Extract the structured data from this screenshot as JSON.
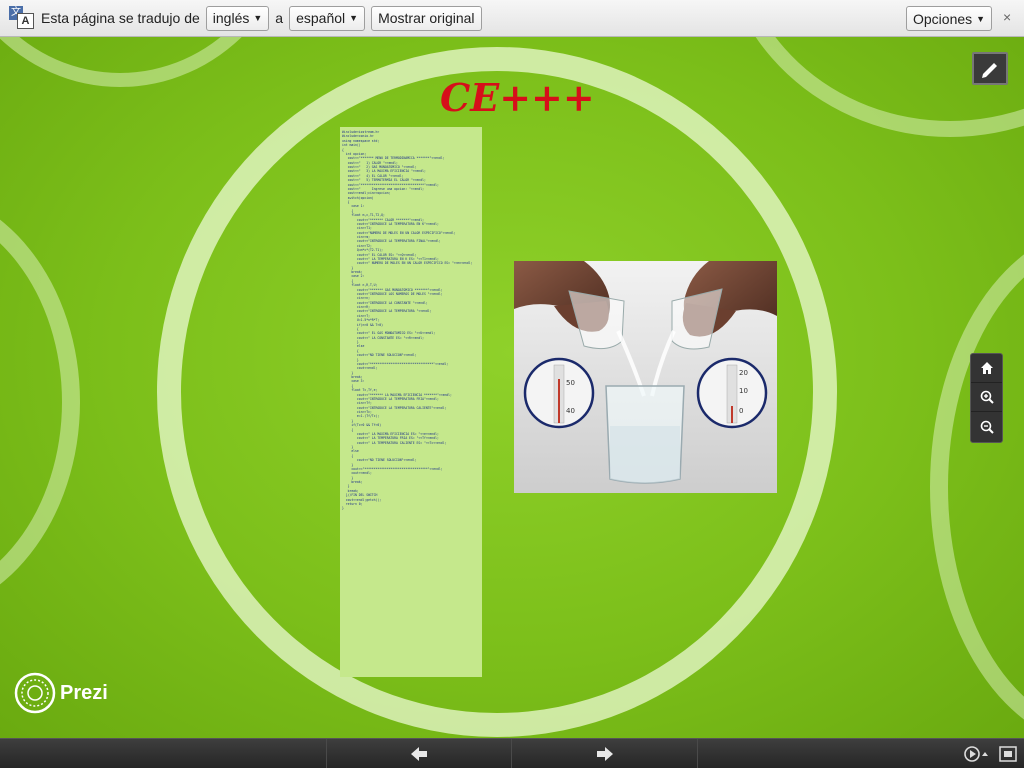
{
  "translate_bar": {
    "message": "Esta página se tradujo de",
    "source_language": "inglés",
    "connector": "a",
    "target_language": "español",
    "show_original_label": "Mostrar original",
    "options_label": "Opciones",
    "close_glyph": "×"
  },
  "presentation": {
    "title": "CE+++",
    "code_lines": [
      "#include<iostream.h>",
      "#include<conio.h>",
      "using namespace std;",
      "int main()",
      "{",
      "  int opcion;",
      "   cout<<\"******* MENU DE TERMODINAMICA *******\"<<endl;",
      "   cout<<\"   1) CALOR \"<<endl;",
      "   cout<<\"   2) GAS MONOATOMICO \"<<endl;",
      "   cout<<\"   3) LA MAXIMA EFICIENCIA \"<<endl;",
      "   cout<<\"   4) EL CALOR \"<<endl;",
      "   cout<<\"   5) TERMOTERMIA EL CALOR \"<<endl;",
      "   cout<<\"**********************************\"<<endl;",
      "   cout<<\"      Ingrese una opcion: \"<<endl;",
      "   cout<<endl;cin>>opcion;",
      "   switch(opcion)",
      "   {",
      "     case 1:",
      "     {",
      "     float m,c,T1,T2,Q;",
      "        cout<<\"******* CALOR *******\"<<endl;",
      "        cout<<\"INTRODUCE LA TEMPERATURA EN K\"<<endl;",
      "        cin>>T1;",
      "        cout<<\"NUMERO DE MOLES EN UN CALOR ESPECIFICO\"<<endl;",
      "        cin>>m;",
      "        cout<<\"INTRODUCE LA TEMPERATURA FINAL\"<<endl;",
      "        cin>>T2;",
      "        Q=m*c*(T2-T1);",
      "",
      "        cout<<\" EL CALOR ES= \"<<Q<<endl;",
      "        cout<<\" LA TEMPERATURA EN K ES= \"<<T1<<endl;",
      "        cout<<\" NUMERO DE MOLES EN UN CALOR ESPECIFICO ES= \"<<m<<endl;",
      "     }",
      "     break;",
      "     case 2:",
      "     {",
      "     float n,R,T,U;",
      "        cout<<\"******* GAS MONOATOMICO *******\"<<endl;",
      "        cout<<\"INTRODUCE LOS NUMEROS DE MOLES \"<<endl;",
      "        cin>>n;",
      "        cout<<\"INTRODUCE LA CONSTANTE \"<<endl;",
      "        cin>>R;",
      "        cout<<\"INTRODUCE LA TEMPERATURA \"<<endl;",
      "        cin>>T;",
      "        U=1.5*n*R*T;",
      "",
      "        if(n>0 && T>0)",
      "        {",
      "        cout<<\" EL GAS MONOATOMICO ES= \"<<U<<endl;",
      "        cout<<\" LA CONSTANTE ES= \"<<R<<endl;",
      "        }",
      "        else",
      "        {",
      "        cout<<\"NO TIENE SOLUCION\"<<endl;",
      "        }",
      "        cout<<\"**********************************\"<<endl;",
      "        cout<<endl;",
      "     }",
      "     break;",
      "     case 3:",
      "     {",
      "     float Tc,Tf,e;",
      "        cout<<\"******* LA MAXIMA EFICIENCIA *******\"<<endl;",
      "        cout<<\"INTRODUCE LA TEMPERATURA FRIA\"<<endl;",
      "        cin>>Tf;",
      "        cout<<\"INTRODUCE LA TEMPERATURA CALIENTE\"<<endl;",
      "        cin>>Tc;",
      "        e=1-(Tf/Tc);",
      "     }",
      "     if(Tc>0 && Tf>0)",
      "     {",
      "        cout<<\" LA MAXIMA EFICIENCIA ES= \"<<e<<endl;",
      "        cout<<\" LA TEMPERATURA FRIA ES= \"<<Tf<<endl;",
      "        cout<<\" LA TEMPERATURA CALIENTE ES= \"<<Tc<<endl;",
      "     }",
      "     else",
      "     {",
      "        cout<<\"NO TIENE SOLUCION\"<<endl;",
      "     }",
      "     cout<<\"**********************************\"<<endl;",
      "     cout<<endl;",
      "     }",
      "     break;",
      "",
      "   }",
      "   break;",
      "  }//FIN DEL SWITCH",
      "",
      "  cout<<endl;getch();",
      "",
      "  return 0;",
      "}"
    ]
  },
  "photo": {
    "thermometer_left_ticks": [
      "50",
      "40"
    ],
    "thermometer_right_ticks": [
      "20",
      "10",
      "0"
    ]
  },
  "controls": {
    "brand": "Prezi"
  },
  "colors": {
    "background": "#7cbf1a",
    "title": "#d60f1a",
    "code_panel": "#c5e88c",
    "code_text": "#1a2e8a"
  }
}
